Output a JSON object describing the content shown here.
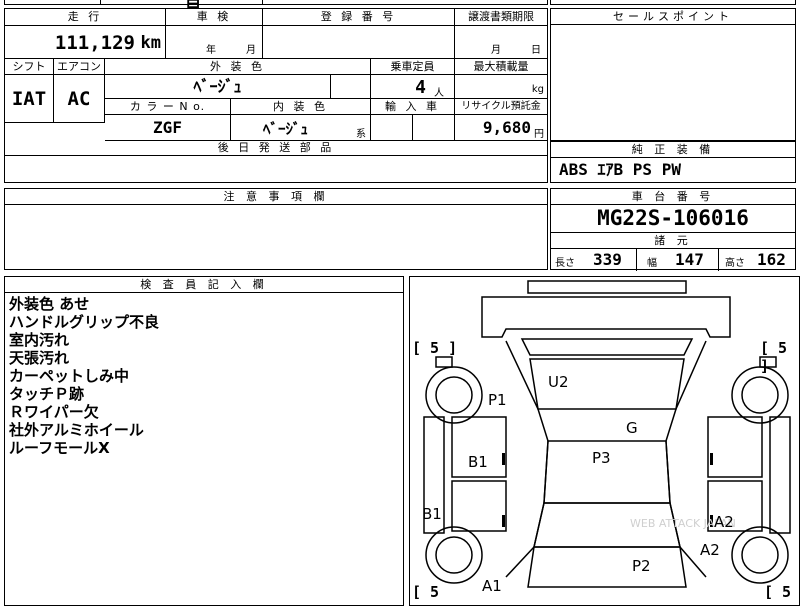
{
  "top_fragment": "自",
  "header": {
    "mileage_label": "走 行",
    "mileage_value": "111,129",
    "mileage_unit": "km",
    "inspection_label": "車 検",
    "inspection_year": "年",
    "inspection_month": "月",
    "registration_label": "登 録 番 号",
    "transfer_label": "譲渡書類期限",
    "transfer_month": "月",
    "transfer_day": "日"
  },
  "spec_row": {
    "shift_label": "シフト",
    "shift_value": "IAT",
    "aircon_label": "エアコン",
    "aircon_value": "AC",
    "ext_color_label": "外 装 色",
    "ext_color_value": "ﾍﾞｰｼﾞｭ",
    "capacity_label": "乗車定員",
    "capacity_value": "4",
    "capacity_unit": "人",
    "load_label": "最大積載量",
    "load_unit": "kg",
    "color_no_label": "カ ラ ー N o.",
    "color_no_value": "ZGF",
    "int_color_label": "内 装 色",
    "int_color_value": "ﾍﾞｰｼﾞｭ",
    "int_color_suffix": "系",
    "import_label": "輸 入 車",
    "recycle_label": "リサイクル預託金",
    "recycle_value": "9,680",
    "recycle_unit": "円",
    "postship_label": "後 日 発 送 部 品"
  },
  "sales_point": {
    "label": "セールスポイント"
  },
  "equipment": {
    "label": "純 正 装 備",
    "value": "ABS ｴｱB PS PW"
  },
  "notes": {
    "label": "注 意 事 項 欄"
  },
  "chassis": {
    "label": "車 台 番 号",
    "value": "MG22S-106016",
    "specs_label": "諸 元",
    "length_label": "長さ",
    "length_value": "339",
    "width_label": "幅",
    "width_value": "147",
    "height_label": "高さ",
    "height_value": "162"
  },
  "inspector": {
    "label": "検 査 員 記 入 欄",
    "remarks": [
      "外装色 あせ",
      "ハンドルグリップ不良",
      "室内汚れ",
      "天張汚れ",
      "カーペットしみ中",
      "タッチＰ跡",
      "Ｒワイパー欠",
      "社外アルミホイール",
      "ルーフモールX"
    ]
  },
  "diagram": {
    "watermark": "WEB ATTACK JAPAN",
    "tire_tl": "[ 5 ]",
    "tire_tr": "[ 5 ]",
    "tire_bl": "[ 5",
    "tire_br": "[ 5",
    "marks": {
      "u2": "U2",
      "p1": "P1",
      "g": "G",
      "b1_side": "B1",
      "p3": "P3",
      "b1_low": "B1",
      "a2_upper": "A2",
      "a2_lower": "A2",
      "p2": "P2",
      "a1": "A1"
    }
  }
}
